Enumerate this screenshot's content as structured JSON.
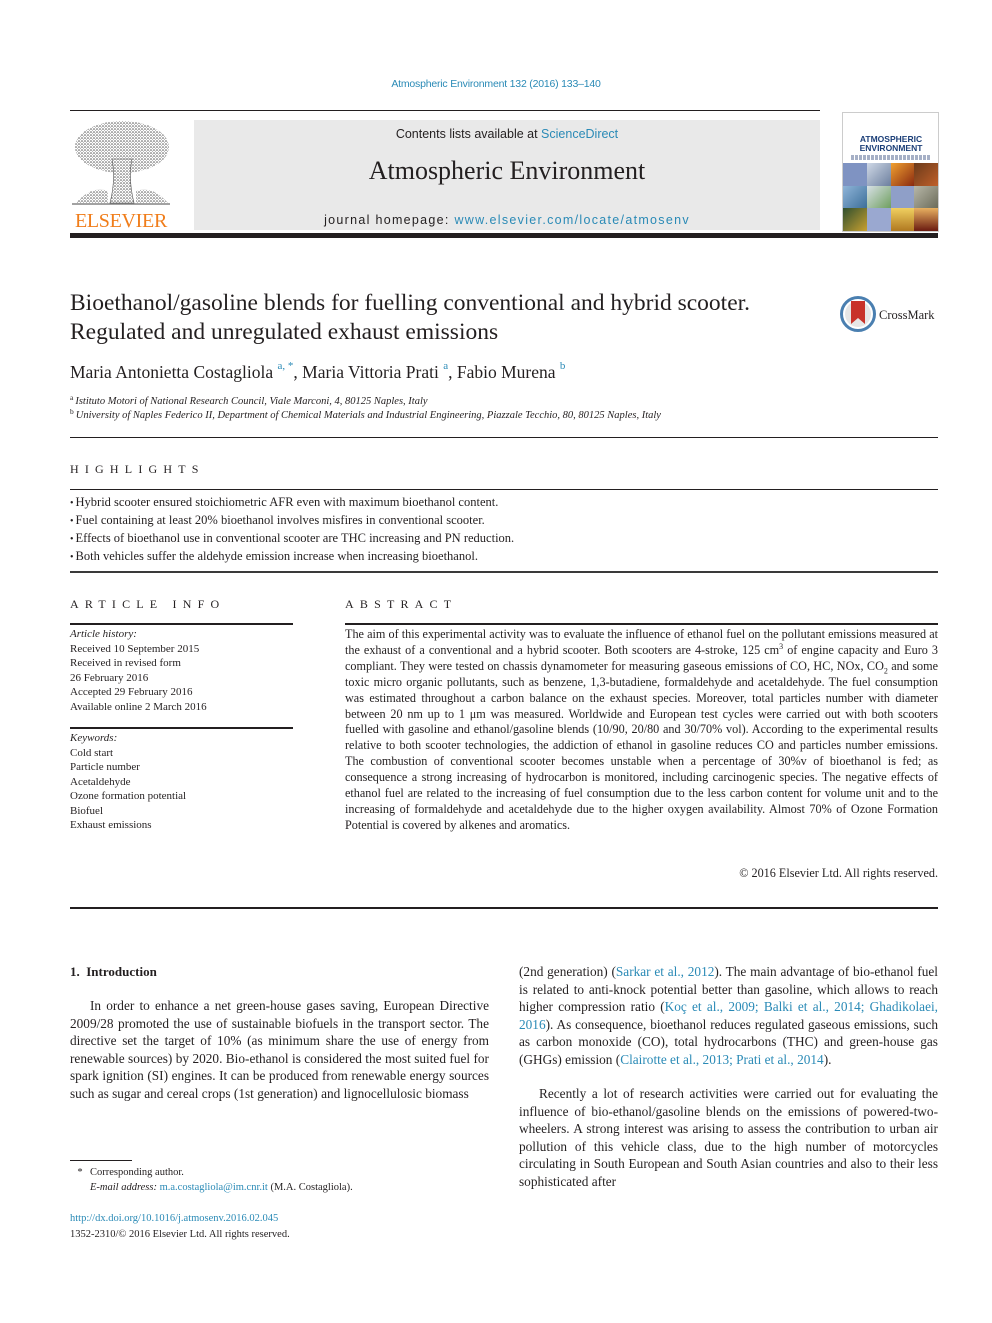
{
  "running_header": "Atmospheric Environment 132 (2016) 133–140",
  "masthead": {
    "publisher_logo": "ELSEVIER",
    "contents_prefix": "Contents lists available at ",
    "contents_link": "ScienceDirect",
    "journal_title": "Atmospheric Environment",
    "homepage_prefix": "journal homepage: ",
    "homepage_url": "www.elsevier.com/locate/atmosenv",
    "cover_title_line1": "ATMOSPHERIC",
    "cover_title_line2": "ENVIRONMENT"
  },
  "article": {
    "title": "Bioethanol/gasoline blends for fuelling conventional and hybrid scooter. Regulated and unregulated exhaust emissions",
    "crossmark_label": "CrossMark",
    "authors": [
      {
        "name": "Maria Antonietta Costagliola",
        "affil": "a, *",
        "sep": ", "
      },
      {
        "name": "Maria Vittoria Prati",
        "affil": "a",
        "sep": ", "
      },
      {
        "name": "Fabio Murena",
        "affil": "b",
        "sep": ""
      }
    ],
    "affiliations": [
      {
        "key": "a",
        "text": "Istituto Motori of National Research Council, Viale Marconi, 4, 80125 Naples, Italy"
      },
      {
        "key": "b",
        "text": "University of Naples Federico II, Department of Chemical Materials and Industrial Engineering, Piazzale Tecchio, 80, 80125 Naples, Italy"
      }
    ]
  },
  "highlights": {
    "heading": "HIGHLIGHTS",
    "items": [
      "Hybrid scooter ensured stoichiometric AFR even with maximum bioethanol content.",
      "Fuel containing at least 20% bioethanol involves misfires in conventional scooter.",
      "Effects of bioethanol use in conventional scooter are THC increasing and PN reduction.",
      "Both vehicles suffer the aldehyde emission increase when increasing bioethanol."
    ]
  },
  "article_info": {
    "heading": "ARTICLE INFO",
    "history_label": "Article history:",
    "history": [
      "Received 10 September 2015",
      "Received in revised form",
      "26 February 2016",
      "Accepted 29 February 2016",
      "Available online 2 March 2016"
    ],
    "keywords_label": "Keywords:",
    "keywords": [
      "Cold start",
      "Particle number",
      "Acetaldehyde",
      "Ozone formation potential",
      "Biofuel",
      "Exhaust emissions"
    ]
  },
  "abstract": {
    "heading": "ABSTRACT",
    "part1": "The aim of this experimental activity was to evaluate the influence of ethanol fuel on the pollutant emissions measured at the exhaust of a conventional and a hybrid scooter. Both scooters are 4-stroke, 125 cm",
    "sup1": "3",
    "part2": " of engine capacity and Euro 3 compliant. They were tested on chassis dynamometer for measuring gaseous emissions of CO, HC, NOx, CO",
    "sub1": "2",
    "part3": " and some toxic micro organic pollutants, such as benzene, 1,3-butadiene, formaldehyde and acetaldehyde. The fuel consumption was estimated throughout a carbon balance on the exhaust species. Moreover, total particles number with diameter between 20 nm up to 1 μm was measured. Worldwide and European test cycles were carried out with both scooters fuelled with gasoline and ethanol/gasoline blends (10/90, 20/80 and 30/70% vol). According to the experimental results relative to both scooter technologies, the addiction of ethanol in gasoline reduces CO and particles number emissions. The combustion of conventional scooter becomes unstable when a percentage of 30%v of bioethanol is fed; as consequence a strong increasing of hydrocarbon is monitored, including carcinogenic species. The negative effects of ethanol fuel are related to the increasing of fuel consumption due to the less carbon content for volume unit and to the increasing of formaldehyde and acetaldehyde due to the higher oxygen availability. Almost 70% of Ozone Formation Potential is covered by alkenes and aromatics.",
    "copyright": "© 2016 Elsevier Ltd. All rights reserved."
  },
  "introduction": {
    "heading": "1.  Introduction",
    "para1": "In order to enhance a net green-house gases saving, European Directive 2009/28 promoted the use of sustainable biofuels in the transport sector. The directive set the target of 10% (as minimum share the use of energy from renewable sources) by 2020. Bio-ethanol is considered the most suited fuel for spark ignition (SI) engines. It can be produced from renewable energy sources such as sugar and cereal crops (1st generation) and lignocellulosic biomass",
    "col2_p1_a": "(2nd generation) (",
    "cite_sarkar": "Sarkar et al., 2012",
    "col2_p1_b": "). The main advantage of bio-ethanol fuel is related to anti-knock potential better than gasoline, which allows to reach higher compression ratio (",
    "cite_koc": "Koç et al., 2009; Balki et al., 2014; Ghadikolaei, 2016",
    "col2_p1_c": "). As consequence, bioethanol reduces regulated gaseous emissions, such as carbon monoxide (CO), total hydrocarbons (THC) and green-house gas (GHGs) emission (",
    "cite_clairotte": "Clairotte et al., 2013; Prati et al., 2014",
    "col2_p1_d": ").",
    "col2_p2": "Recently a lot of research activities were carried out for evaluating the influence of bio-ethanol/gasoline blends on the emissions of powered-two-wheelers. A strong interest was arising to assess the contribution to urban air pollution of this vehicle class, due to the high number of motorcycles circulating in South European and South Asian countries and also to their less sophisticated after"
  },
  "footnote": {
    "star": "*",
    "corresponding": "Corresponding author.",
    "email_label": "E-mail address:",
    "email": "m.a.costagliola@im.cnr.it",
    "email_owner": " (M.A. Costagliola)."
  },
  "doi": {
    "url": "http://dx.doi.org/10.1016/j.atmosenv.2016.02.045",
    "issn_line": "1352-2310/© 2016 Elsevier Ltd. All rights reserved."
  },
  "colors": {
    "link": "#2a8ab6",
    "elsevier_orange": "#f07d1a",
    "masthead_bg": "#e9e9e9",
    "text": "#231f20"
  }
}
